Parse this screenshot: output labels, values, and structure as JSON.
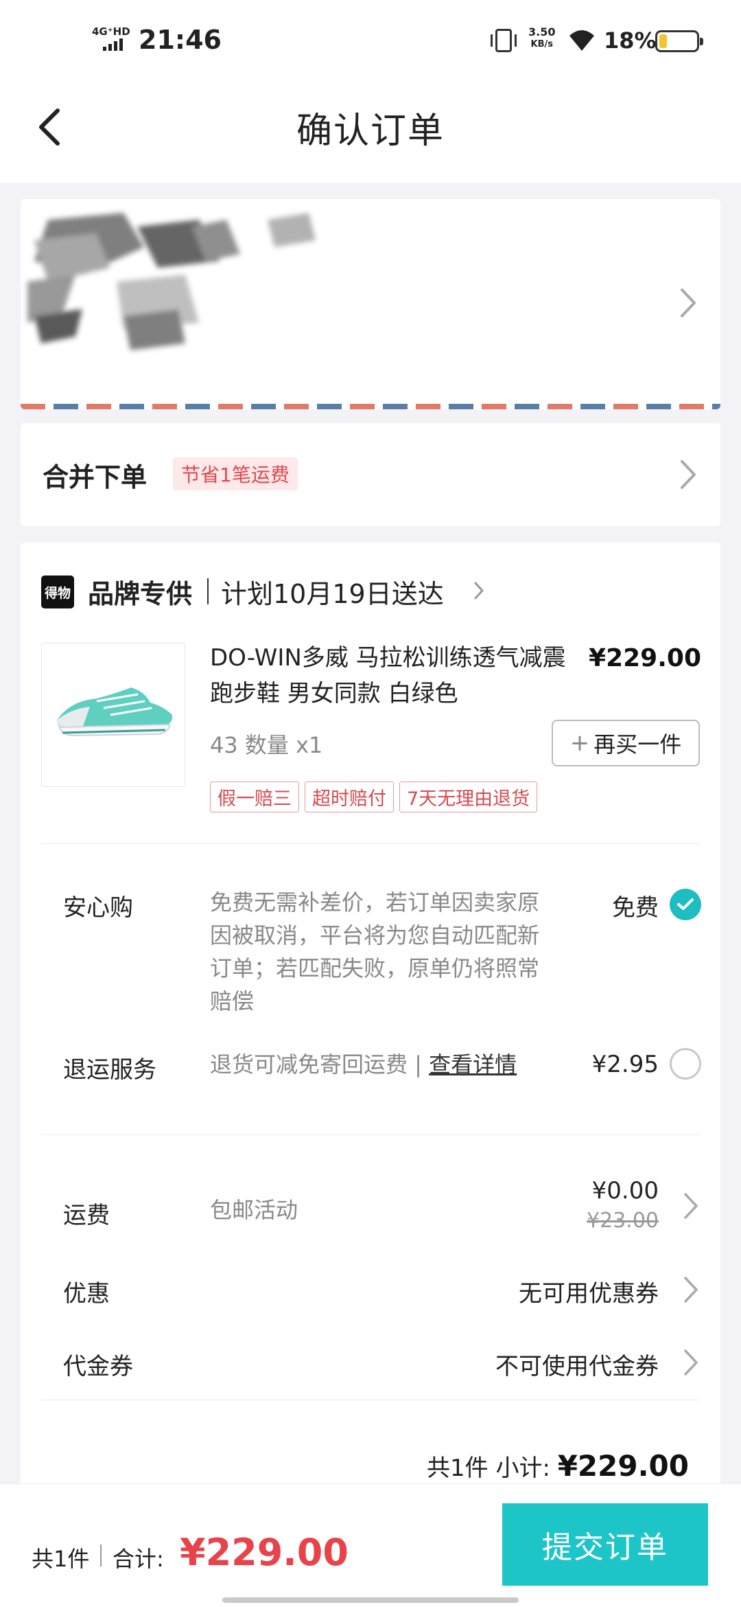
{
  "status_bar": {
    "network": "4G⁺HD",
    "time": "21:46",
    "speed_value": "3.50",
    "speed_unit": "KB/s",
    "battery_pct": "18%"
  },
  "nav": {
    "title": "确认订单"
  },
  "merge": {
    "title": "合并下单",
    "badge": "节省1笔运费"
  },
  "brand": {
    "logo_text": "得物",
    "name": "品牌专供",
    "delivery": "计划10月19日送达"
  },
  "product": {
    "title": "DO-WIN多威 马拉松训练透气减震跑步鞋 男女同款 白绿色",
    "price": "¥229.00",
    "spec": "43 数量 x1",
    "rebuy_label": "再买一件",
    "tags": [
      "假一赔三",
      "超时赔付",
      "7天无理由退货"
    ]
  },
  "services": {
    "anxin": {
      "label": "安心购",
      "desc": "免费无需补差价，若订单因卖家原因被取消，平台将为您自动匹配新订单；若匹配失败，原单仍将照常赔偿",
      "value": "免费",
      "checked": true
    },
    "return": {
      "label": "退运服务",
      "desc": "退货可减免寄回运费 | ",
      "link": "查看详情",
      "value": "¥2.95",
      "checked": false
    }
  },
  "fees": {
    "shipping": {
      "label": "运费",
      "desc": "包邮活动",
      "value": "¥0.00",
      "original": "¥23.00"
    },
    "discount": {
      "label": "优惠",
      "value": "无可用优惠券"
    },
    "voucher": {
      "label": "代金券",
      "value": "不可使用代金券"
    }
  },
  "subtotal": {
    "label": "共1件 小计: ",
    "amount": "¥229.00"
  },
  "bottom": {
    "count": "共1件",
    "total_label": "合计: ",
    "total": "¥229.00",
    "submit": "提交订单"
  },
  "colors": {
    "accent": "#1ec5c8",
    "price_red": "#e8424a",
    "tag_red": "#d8484f"
  }
}
